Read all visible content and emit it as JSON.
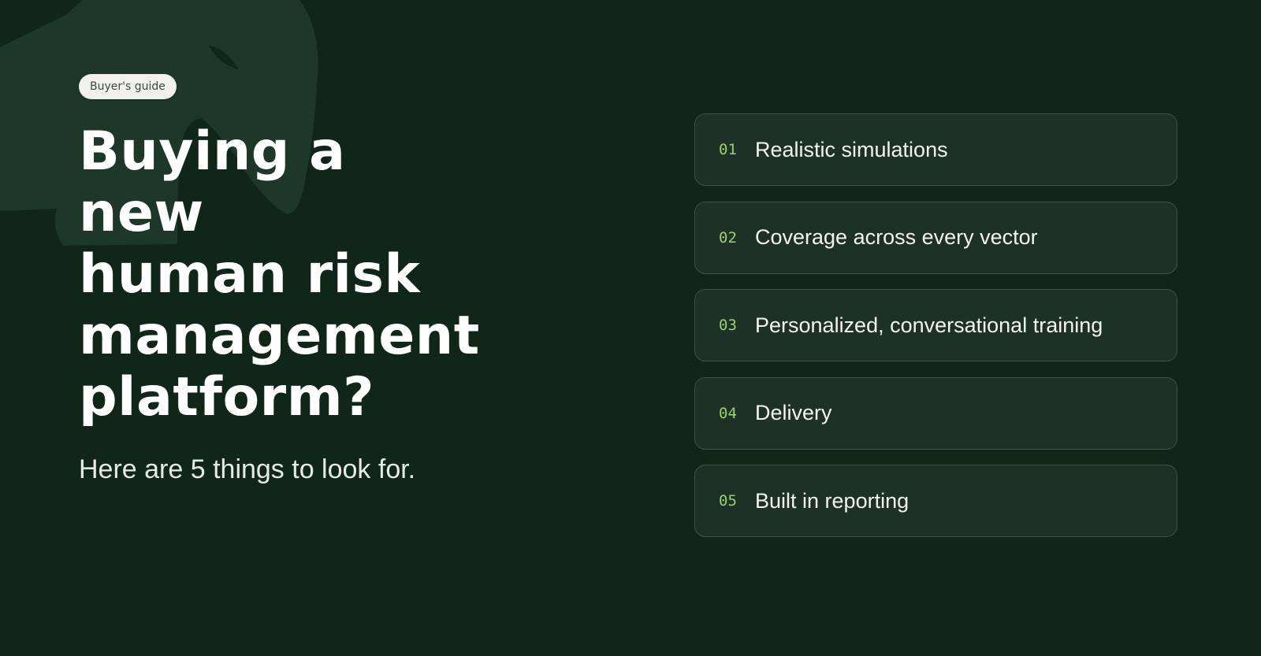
{
  "colors": {
    "background": "#0f2619",
    "card": "#1e3126",
    "card_border": "#3c5544",
    "accent_number": "#9ccf6f",
    "badge_bg": "#f1f0ea"
  },
  "background_icon": "elephant-silhouette-icon",
  "badge": {
    "label": "Buyer's guide"
  },
  "headline": {
    "line1": "Buying a new",
    "line2": "human risk",
    "line3": "management",
    "line4": "platform?"
  },
  "subhead": "Here are 5 things to look for.",
  "items": [
    {
      "number": "01",
      "label": "Realistic simulations"
    },
    {
      "number": "02",
      "label": "Coverage across every vector"
    },
    {
      "number": "03",
      "label": "Personalized, conversational training"
    },
    {
      "number": "04",
      "label": "Delivery"
    },
    {
      "number": "05",
      "label": "Built in reporting"
    }
  ]
}
